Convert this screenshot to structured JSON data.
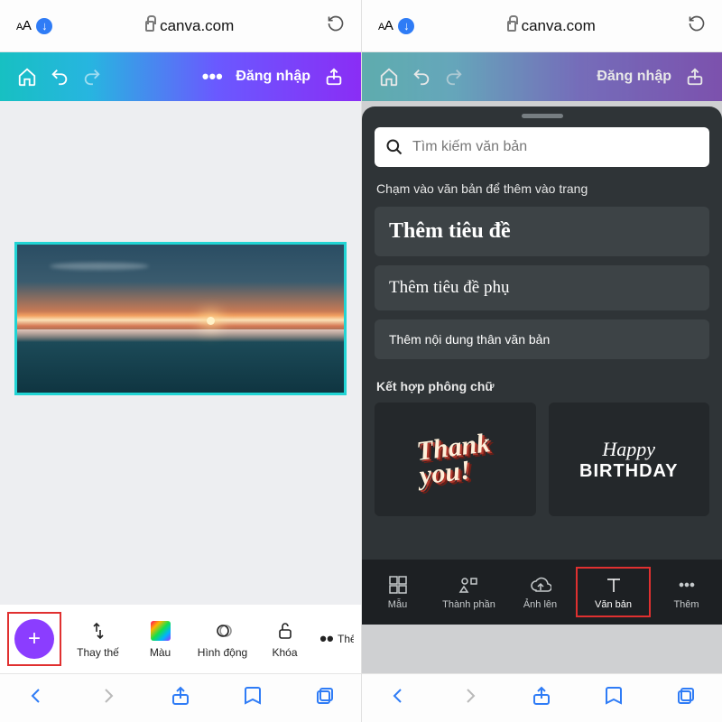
{
  "browser": {
    "url": "canva.com",
    "aa_small": "A",
    "aa_big": "A"
  },
  "toolbar": {
    "login": "Đăng nhập"
  },
  "left": {
    "editbar": {
      "replace": "Thay thế",
      "color": "Màu",
      "animate": "Hình động",
      "lock": "Khóa",
      "more_cut": "Thê"
    }
  },
  "right": {
    "search_placeholder": "Tìm kiếm văn bản",
    "hint": "Chạm vào văn bản để thêm vào trang",
    "add_heading": "Thêm tiêu đề",
    "add_subheading": "Thêm tiêu đề phụ",
    "add_body": "Thêm nội dung thân văn bản",
    "combo_label": "Kết hợp phông chữ",
    "combo_thank_1": "Thank",
    "combo_thank_2": "you!",
    "combo_happy": "Happy",
    "combo_bday": "BIRTHDAY",
    "nav": {
      "templates": "Mẫu",
      "elements": "Thành phần",
      "uploads": "Ảnh lên",
      "text": "Văn bản",
      "more": "Thêm"
    }
  }
}
